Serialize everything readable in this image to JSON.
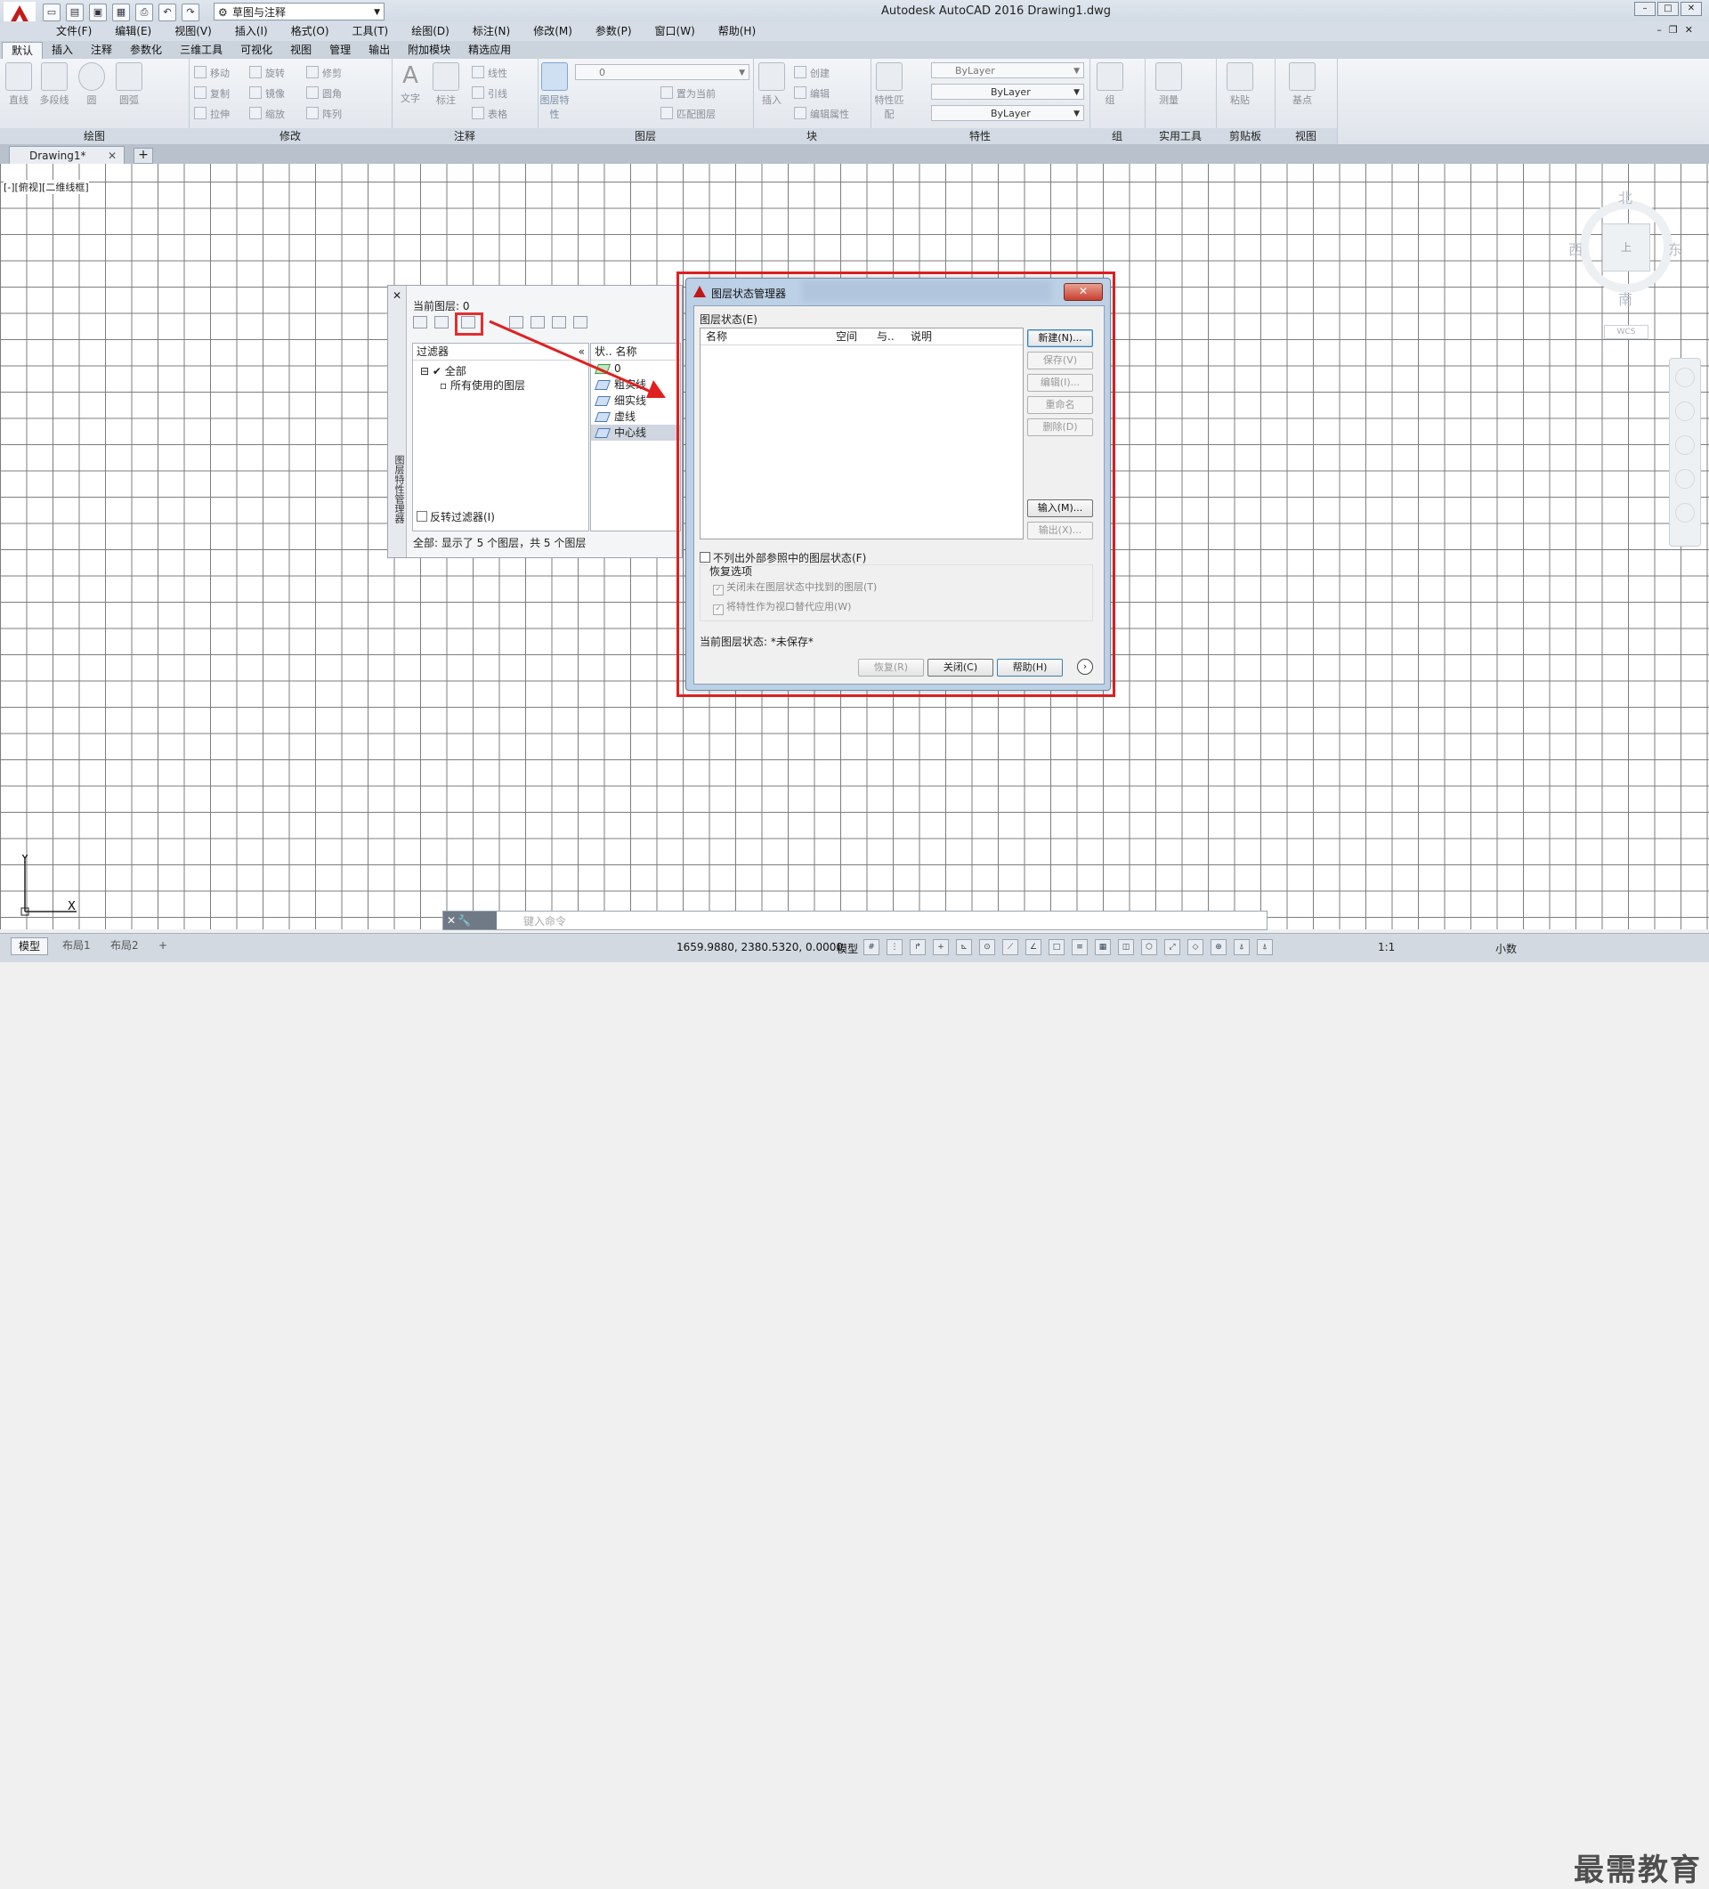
{
  "app": {
    "window_title": "Autodesk AutoCAD 2016    Drawing1.dwg",
    "workspace": "草图与注释"
  },
  "menu": [
    "文件(F)",
    "编辑(E)",
    "视图(V)",
    "插入(I)",
    "格式(O)",
    "工具(T)",
    "绘图(D)",
    "标注(N)",
    "修改(M)",
    "参数(P)",
    "窗口(W)",
    "帮助(H)"
  ],
  "ribbon_tabs": [
    "默认",
    "插入",
    "注释",
    "参数化",
    "三维工具",
    "可视化",
    "视图",
    "管理",
    "输出",
    "附加模块",
    "精选应用"
  ],
  "ribbon": {
    "draw": {
      "label": "绘图",
      "tools": [
        "直线",
        "多段线",
        "圆",
        "圆弧"
      ]
    },
    "modify": {
      "label": "修改",
      "tools": [
        "移动",
        "旋转",
        "修剪",
        "复制",
        "镜像",
        "圆角",
        "拉伸",
        "缩放",
        "阵列"
      ]
    },
    "annotation": {
      "label": "注释",
      "tools": [
        "文字",
        "标注",
        "线性",
        "引线",
        "表格"
      ]
    },
    "layers": {
      "label": "图层",
      "big_tool": "图层特性",
      "current": "0",
      "tools": [
        "置为当前",
        "匹配图层"
      ]
    },
    "block": {
      "label": "块",
      "big_tool": "插入",
      "tools": [
        "创建",
        "编辑",
        "编辑属性"
      ]
    },
    "properties": {
      "label": "特性",
      "big_tool": "特性匹配",
      "color": "ByLayer",
      "linetype": "ByLayer",
      "lineweight": "ByLayer"
    },
    "groups": {
      "label": "组",
      "big_tool": "组"
    },
    "utilities": {
      "label": "实用工具",
      "big_tool": "测量"
    },
    "clipboard": {
      "label": "剪贴板",
      "big_tool": "粘贴"
    },
    "view": {
      "label": "视图",
      "big_tool": "基点"
    }
  },
  "doc_tab": "Drawing1*",
  "viewport_label": "[-][俯视][二维线框]",
  "viewcube": {
    "north": "北",
    "south": "南",
    "east": "东",
    "west": "西",
    "wcs": "WCS"
  },
  "ucs": {
    "x": "X",
    "y": "Y"
  },
  "layer_palette": {
    "current_layer": "当前图层: 0",
    "side_title": "图层特性管理器",
    "filter_header": "过滤器",
    "filter_all": "全部",
    "filter_used": "所有使用的图层",
    "invert_filter": "反转过滤器(I)",
    "list_header": "状.. 名称",
    "layers": [
      "0",
      "粗实线",
      "细实线",
      "虚线",
      "中心线"
    ],
    "status": "全部: 显示了 5 个图层，共 5 个图层"
  },
  "layer_states_dialog": {
    "title": "图层状态管理器",
    "close": "✕",
    "list_label": "图层状态(E)",
    "columns": [
      "名称",
      "空间",
      "与..",
      "说明"
    ],
    "buttons": {
      "new": "新建(N)...",
      "save": "保存(V)",
      "edit": "编辑(I)...",
      "rename": "重命名",
      "delete": "删除(D)",
      "import": "输入(M)...",
      "export": "输出(X)..."
    },
    "no_xref": "不列出外部参照中的图层状态(F)",
    "restore_options": "恢复选项",
    "restore_1": "关闭未在图层状态中找到的图层(T)",
    "restore_2": "将特性作为视口替代应用(W)",
    "current_state": "当前图层状态:  *未保存*",
    "bottom": {
      "restore": "恢复(R)",
      "close": "关闭(C)",
      "help": "帮助(H)"
    }
  },
  "command_line": {
    "placeholder": "键入命令"
  },
  "status_bar": {
    "layouts": [
      "模型",
      "布局1",
      "布局2"
    ],
    "coords": "1659.9880, 2380.5320, 0.0000",
    "model": "模型",
    "scale": "1:1",
    "units": "小数"
  },
  "watermark": "最需教育"
}
